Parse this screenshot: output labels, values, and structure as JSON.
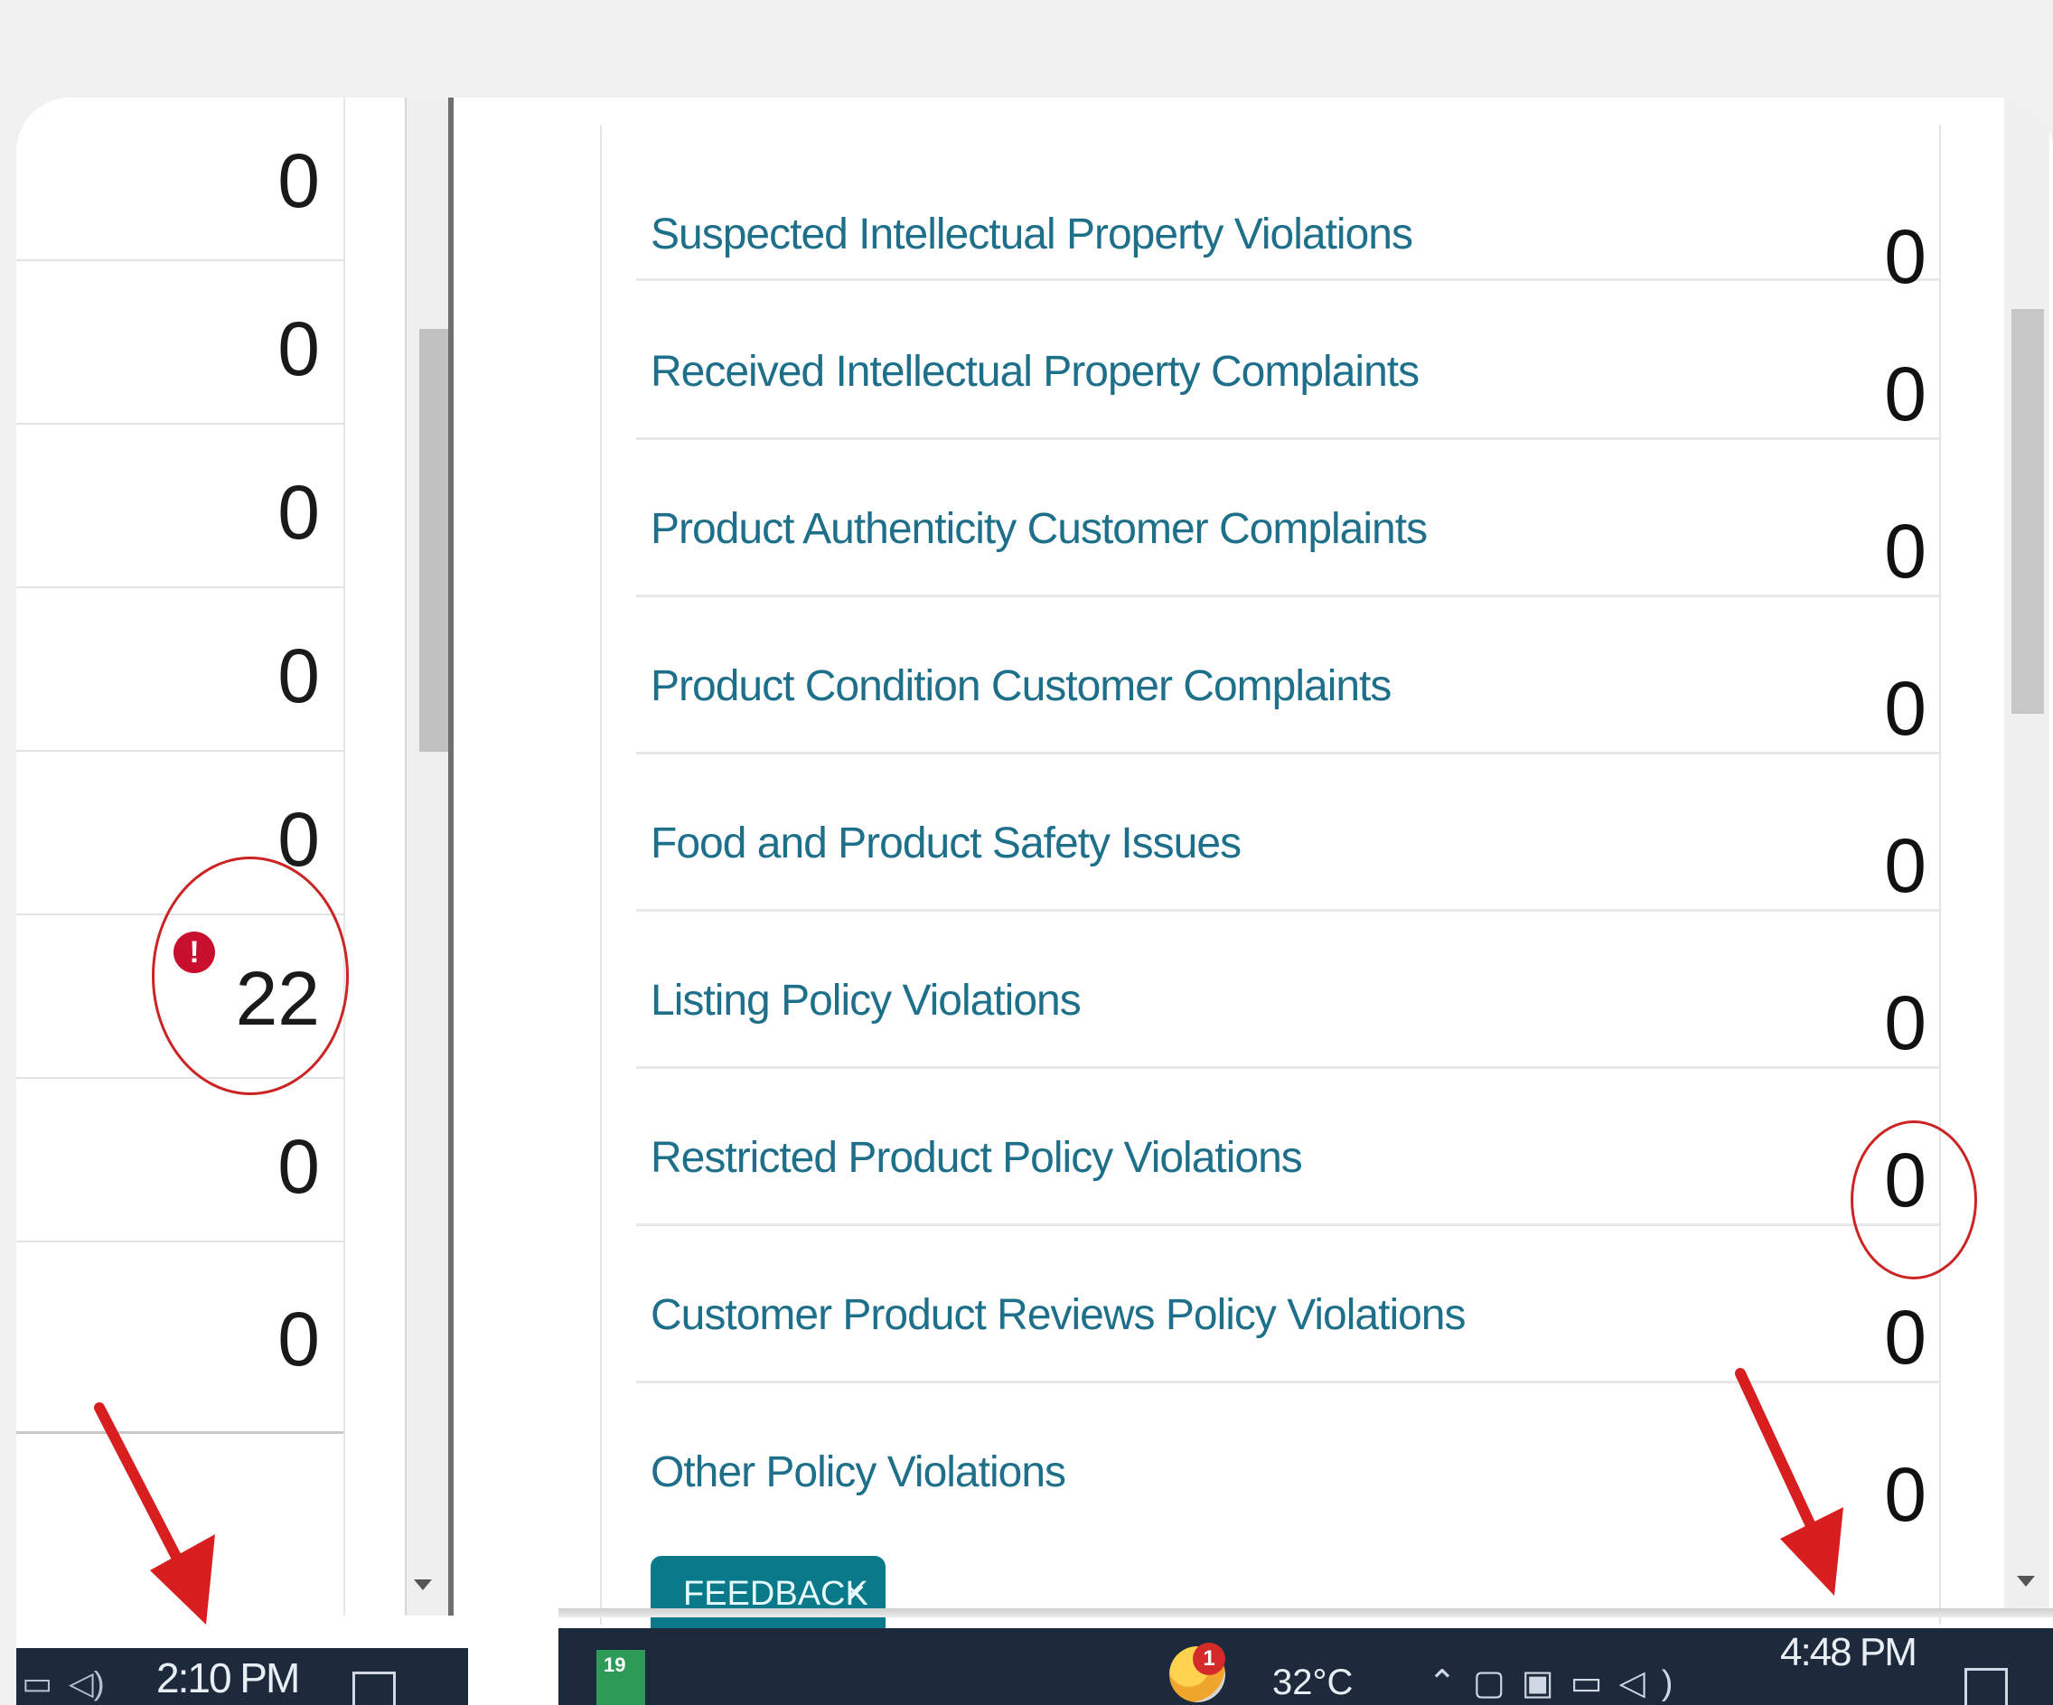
{
  "left_panel": {
    "counts": [
      "0",
      "0",
      "0",
      "0",
      "0",
      "22",
      "0",
      "0"
    ],
    "highlighted_count": "22",
    "alert_icon": "exclamation-alert-icon",
    "taskbar": {
      "clock": "2:10 PM"
    }
  },
  "right_panel": {
    "metrics": [
      {
        "label": "Suspected Intellectual Property Violations",
        "count": "0"
      },
      {
        "label": "Received Intellectual Property Complaints",
        "count": "0"
      },
      {
        "label": "Product Authenticity Customer Complaints",
        "count": "0"
      },
      {
        "label": "Product Condition Customer Complaints",
        "count": "0"
      },
      {
        "label": "Food and Product Safety Issues",
        "count": "0"
      },
      {
        "label": "Listing Policy Violations",
        "count": "0"
      },
      {
        "label": "Restricted Product Policy Violations",
        "count": "0"
      },
      {
        "label": "Customer Product Reviews Policy Violations",
        "count": "0"
      },
      {
        "label": "Other Policy Violations",
        "count": "0"
      }
    ],
    "feedback": {
      "label": "FEEDBACK",
      "close_glyph": "×"
    },
    "taskbar": {
      "calendar_tile": "19",
      "weather_badge": "1",
      "temperature": "32°C",
      "clock": "4:48 PM"
    }
  },
  "colors": {
    "link_teal": "#1e6f8a",
    "annotation_red": "#cc2424",
    "feedback_bg": "#0a7a8a",
    "taskbar_bg": "#1d2a3b"
  }
}
